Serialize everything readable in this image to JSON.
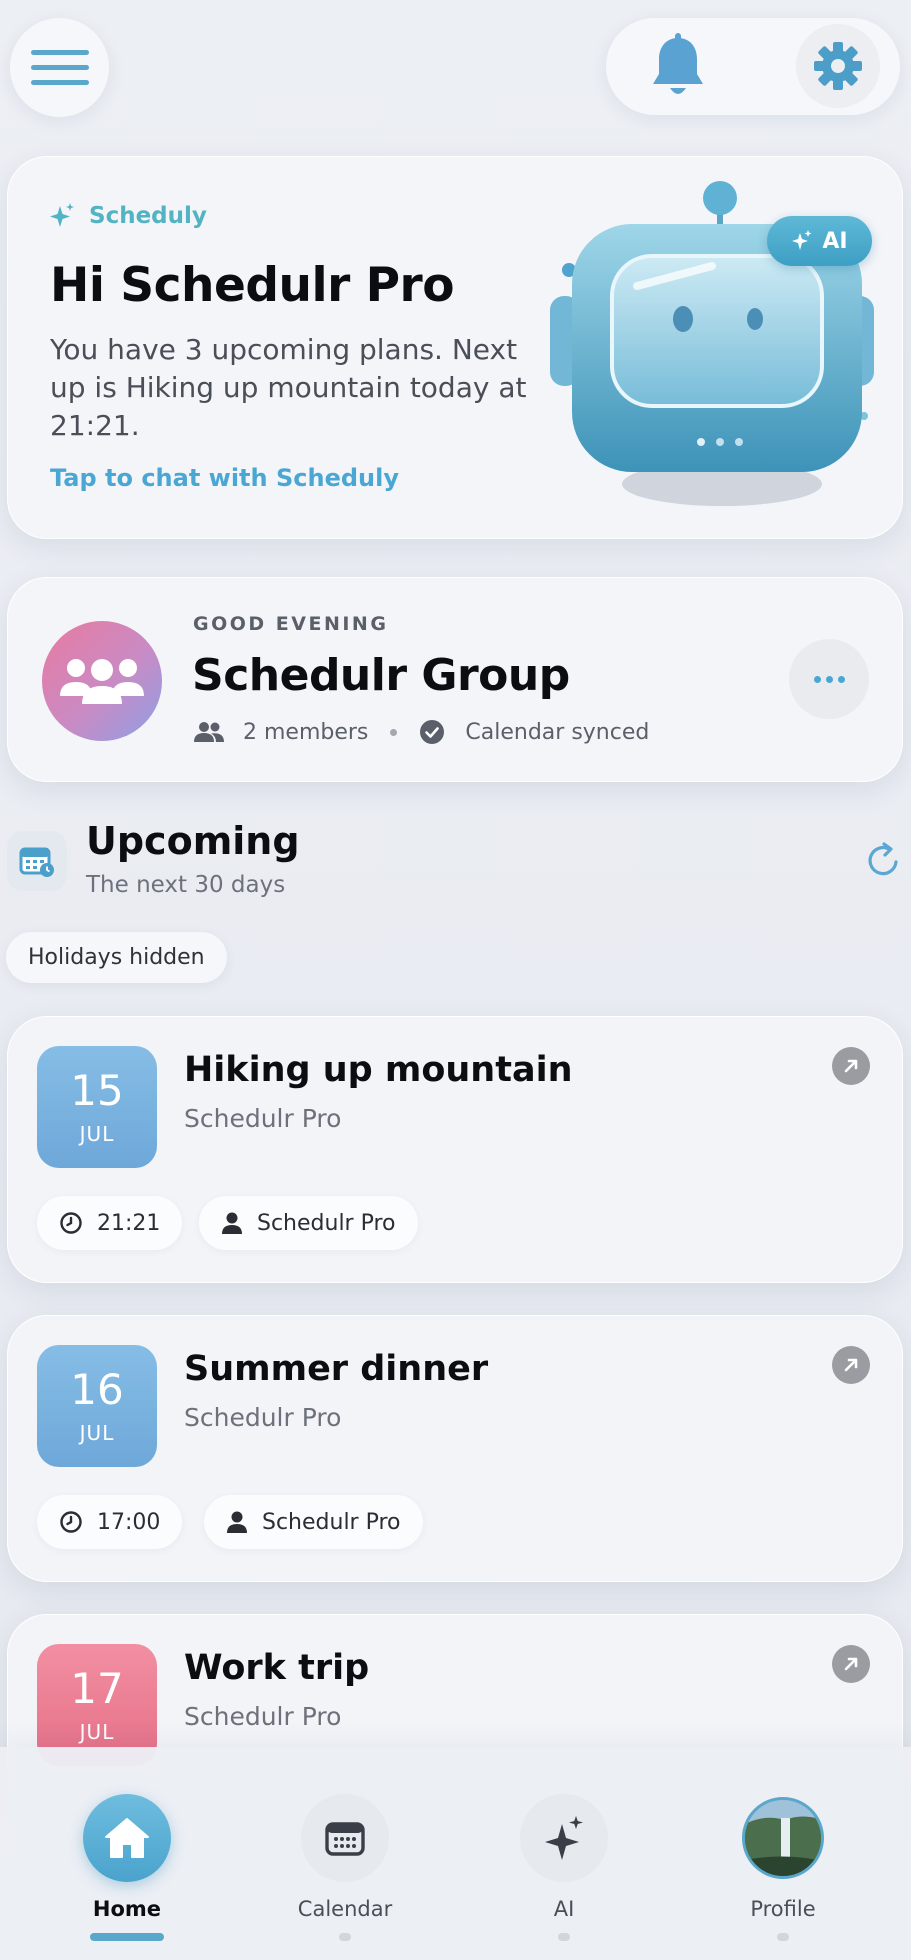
{
  "topbar": {
    "menu_icon": "hamburger-icon",
    "bell_icon": "bell-icon",
    "settings_icon": "gear-icon"
  },
  "hero": {
    "brand": "Scheduly",
    "title": "Hi Schedulr Pro",
    "text": "You have 3 upcoming plans. Next up is Hiking up mountain today at 21:21.",
    "link": "Tap to chat with Scheduly",
    "ai_chip": "AI",
    "accent": "#52b3c3"
  },
  "group": {
    "eyebrow": "GOOD EVENING",
    "name": "Schedulr Group",
    "members": "2 members",
    "sync_status": "Calendar synced"
  },
  "upcoming": {
    "title": "Upcoming",
    "subtitle": "The next 30 days",
    "filter_pill": "Holidays hidden"
  },
  "events": [
    {
      "day": "15",
      "month": "JUL",
      "title": "Hiking up mountain",
      "owner": "Schedulr Pro",
      "time": "21:21",
      "person": "Schedulr Pro",
      "color": "#7cb4e0"
    },
    {
      "day": "16",
      "month": "JUL",
      "title": "Summer dinner",
      "owner": "Schedulr Pro",
      "time": "17:00",
      "person": "Schedulr Pro",
      "color": "#7cb4e0"
    },
    {
      "day": "17",
      "month": "JUL",
      "title": "Work trip",
      "owner": "Schedulr Pro",
      "time": "",
      "person": "",
      "color": "#ef8398"
    }
  ],
  "nav": {
    "items": [
      {
        "label": "Home",
        "icon": "home-icon",
        "active": true
      },
      {
        "label": "Calendar",
        "icon": "calendar-icon",
        "active": false
      },
      {
        "label": "AI",
        "icon": "sparkle-icon",
        "active": false
      },
      {
        "label": "Profile",
        "icon": "profile-avatar",
        "active": false
      }
    ],
    "accent": "#5aa7cc"
  }
}
